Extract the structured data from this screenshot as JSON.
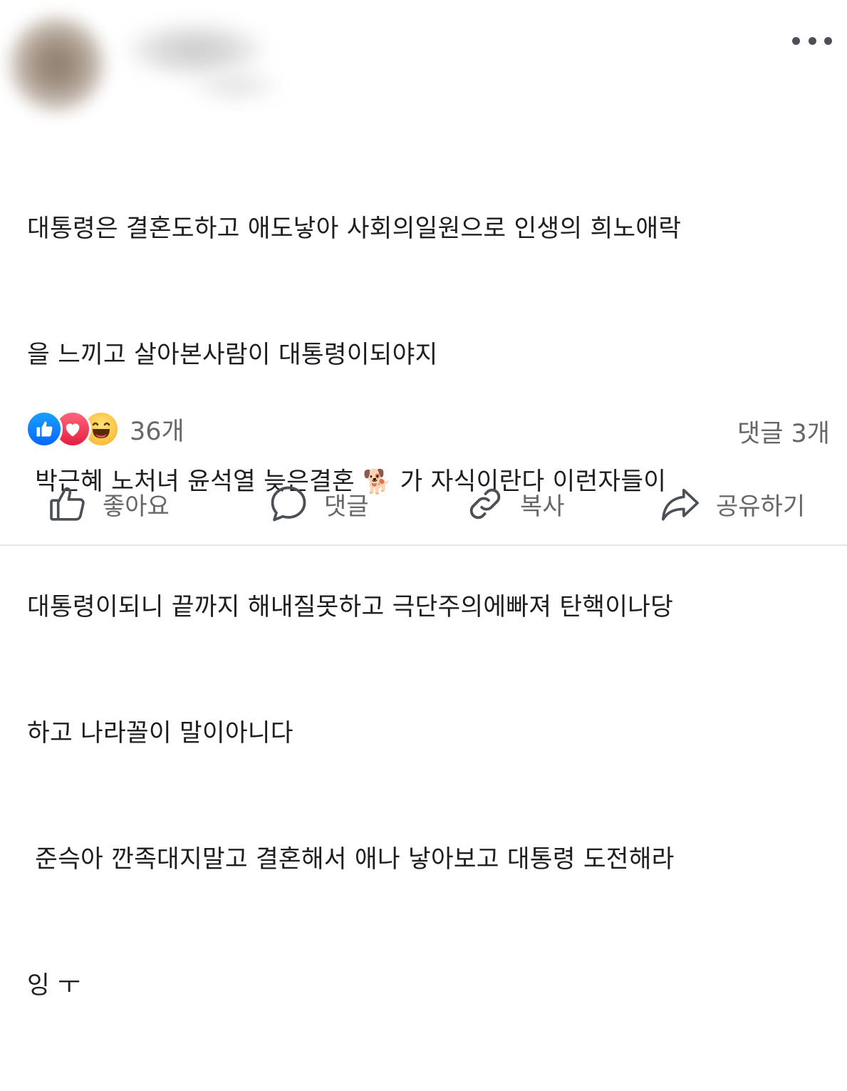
{
  "post": {
    "text_lines": [
      "대통령은 결혼도하고 애도낳아 사회의일원으로 인생의 희노애락",
      "을 느끼고 살아본사람이 대통령이되야지",
      " 박근혜 노처녀 윤석열 늦은결혼 ",
      "대통령이되니 끝까지 해내질못하고 극단주의에빠져 탄핵이나당",
      "하고 나라꼴이 말이아니다",
      " 준슥아 깐족대지말고 결혼해서 애나 낳아보고 대통령 도전해라",
      "잉 ㅜ"
    ],
    "line3_emoji": "🐕",
    "line3_tail": " 가 자식이란다 이런자들이"
  },
  "header": {
    "more_icon": "more-horizontal-icon"
  },
  "reactions": {
    "icons": [
      "like-icon",
      "love-icon",
      "haha-icon"
    ],
    "count": "36개"
  },
  "comments": {
    "count": "댓글 3개"
  },
  "actions": {
    "like_label": "좋아요",
    "comment_label": "댓글",
    "copy_label": "복사",
    "share_label": "공유하기"
  },
  "colors": {
    "text": "#1c1e21",
    "secondary": "#65676b",
    "like_blue": "#0866ff",
    "love_red": "#e41e3f",
    "haha_yellow": "#f7b125"
  }
}
